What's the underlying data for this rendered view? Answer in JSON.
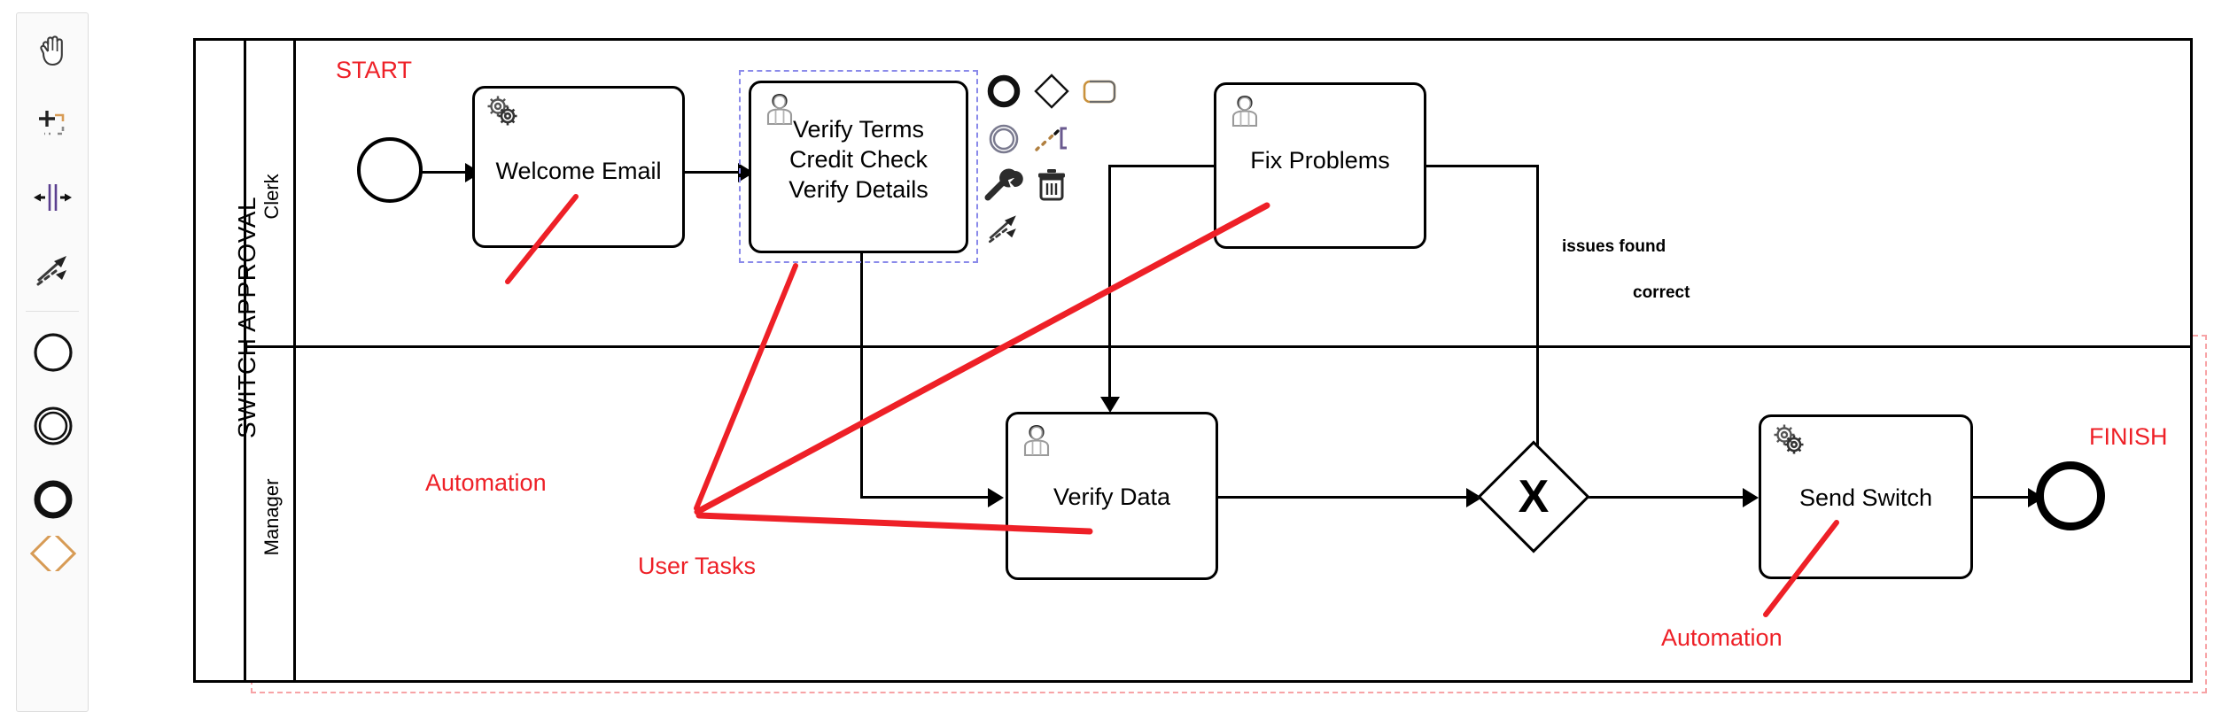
{
  "palette": {
    "name": "bpmn-palette",
    "tools": [
      {
        "id": "hand-tool",
        "label": "Activate the hand tool",
        "icon": "hand-icon"
      },
      {
        "id": "lasso-tool",
        "label": "Activate the lasso tool",
        "icon": "lasso-icon"
      },
      {
        "id": "space-tool",
        "label": "Activate the create/remove space tool",
        "icon": "space-icon"
      },
      {
        "id": "global-connect-tool",
        "label": "Activate the global connect tool",
        "icon": "connect-arrow-icon"
      }
    ],
    "shapes": [
      {
        "id": "create-start-event",
        "label": "Create StartEvent",
        "icon": "start-event-icon"
      },
      {
        "id": "create-intermediate-event",
        "label": "Create Intermediate/Boundary Event",
        "icon": "intermediate-event-icon"
      },
      {
        "id": "create-end-event",
        "label": "Create EndEvent",
        "icon": "end-event-icon"
      }
    ]
  },
  "diagram": {
    "pool": {
      "name": "SWITCH APPROVAL",
      "lanes": [
        {
          "name": "Clerk"
        },
        {
          "name": "Manager"
        }
      ]
    },
    "events": [
      {
        "id": "start-event",
        "type": "start",
        "label": "START",
        "lane": "Clerk"
      },
      {
        "id": "end-event",
        "type": "end",
        "label": "FINISH",
        "lane": "Manager"
      }
    ],
    "tasks": [
      {
        "id": "welcome-email",
        "label": "Welcome Email",
        "type": "service",
        "lane": "Clerk",
        "selected": false
      },
      {
        "id": "verify-terms",
        "label": "Verify Terms\nCredit Check\nVerify Details",
        "lines": [
          "Verify Terms",
          "Credit Check",
          "Verify Details"
        ],
        "type": "user",
        "lane": "Clerk",
        "selected": true
      },
      {
        "id": "fix-problems",
        "label": "Fix Problems",
        "type": "user",
        "lane": "Clerk",
        "selected": false
      },
      {
        "id": "verify-data",
        "label": "Verify Data",
        "type": "user",
        "lane": "Manager",
        "selected": false
      },
      {
        "id": "send-switch",
        "label": "Send Switch",
        "type": "service",
        "lane": "Manager",
        "selected": false
      }
    ],
    "gateways": [
      {
        "id": "exclusive-gateway",
        "type": "exclusive",
        "symbol": "X",
        "lane": "Manager"
      }
    ],
    "flow_labels": [
      {
        "id": "issues-found-label",
        "text": "issues found"
      },
      {
        "id": "correct-label",
        "text": "correct"
      }
    ]
  },
  "annotations": [
    {
      "id": "annotation-automation-1",
      "text": "Automation",
      "color": "#ee2027"
    },
    {
      "id": "annotation-user-tasks",
      "text": "User Tasks",
      "color": "#ee2027"
    },
    {
      "id": "annotation-automation-2",
      "text": "Automation",
      "color": "#ee2027"
    }
  ],
  "context_pad": {
    "target": "verify-terms",
    "items": [
      {
        "id": "append-end-event",
        "label": "Append EndEvent",
        "icon": "end-event-icon"
      },
      {
        "id": "append-gateway",
        "label": "Append Gateway",
        "icon": "gateway-icon"
      },
      {
        "id": "append-task",
        "label": "Append Task",
        "icon": "task-icon"
      },
      {
        "id": "append-intermediate-event",
        "label": "Append Intermediate/Boundary Event",
        "icon": "intermediate-event-icon"
      },
      {
        "id": "append-text-annotation",
        "label": "Append TextAnnotation",
        "icon": "text-annotation-icon"
      },
      {
        "id": "change-type",
        "label": "Change type",
        "icon": "wrench-icon"
      },
      {
        "id": "delete-element",
        "label": "Remove",
        "icon": "trash-icon"
      },
      {
        "id": "connect",
        "label": "Connect using Sequence/MessageFlow or Association",
        "icon": "connect-arrow-icon"
      }
    ]
  },
  "colors": {
    "stroke": "#000000",
    "annotation_red": "#ee2027",
    "selection_blue": "#8a8aea",
    "guide_pink": "#f7a3a6",
    "palette_bg": "#fafafa"
  }
}
